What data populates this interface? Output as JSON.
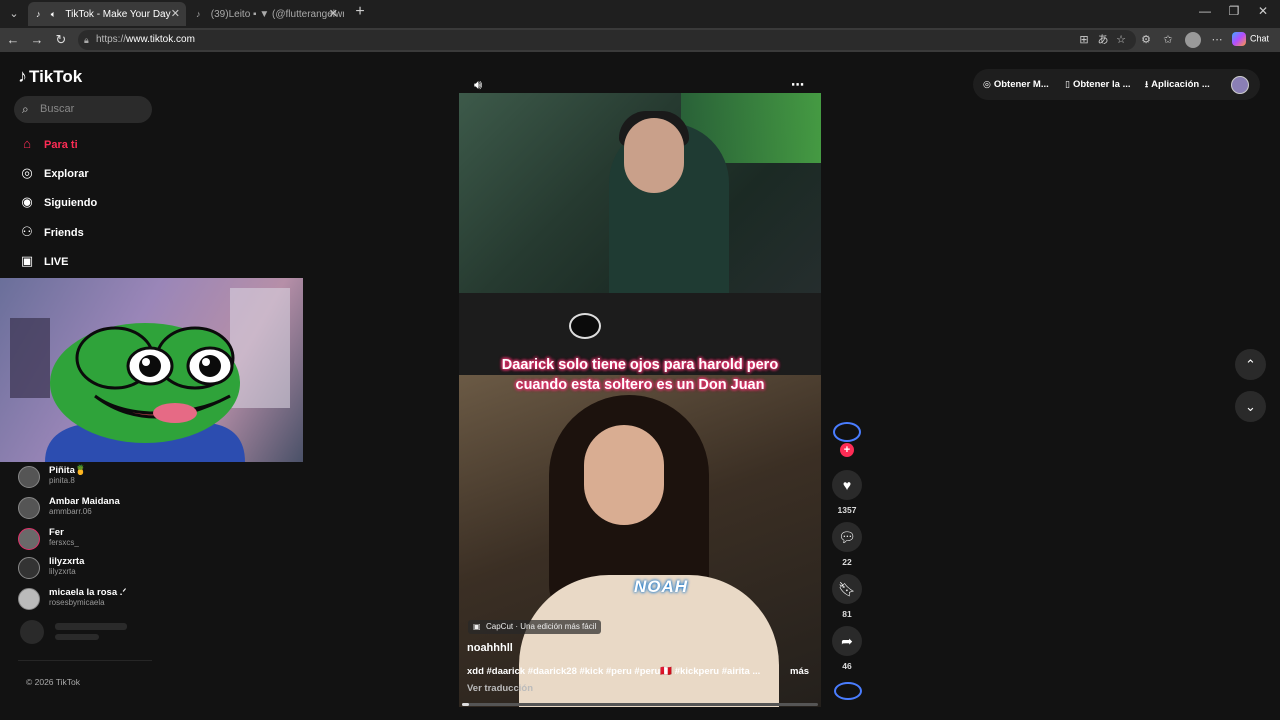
{
  "browser": {
    "tabs": [
      {
        "label": "TikTok - Make Your Day",
        "active": true
      },
      {
        "label": "(39)Leito ▪ ▼ (@flutterangelwrr",
        "active": false
      }
    ],
    "url_scheme": "https://",
    "url_host": "www.tiktok.com",
    "chat_label": "Chat"
  },
  "sidebar": {
    "logo": "TikTok",
    "search_placeholder": "Buscar",
    "nav": [
      {
        "label": "Para ti",
        "icon": "home-icon",
        "active": true
      },
      {
        "label": "Explorar",
        "icon": "compass-icon",
        "active": false
      },
      {
        "label": "Siguiendo",
        "icon": "following-avatar-icon",
        "active": false
      },
      {
        "label": "Friends",
        "icon": "friends-icon",
        "active": false
      },
      {
        "label": "LIVE",
        "icon": "live-icon",
        "active": false
      }
    ],
    "following_accounts": [
      {
        "name": "Piñita🍍",
        "handle": "pinita.8"
      },
      {
        "name": "Ambar Maidana",
        "handle": "ammbarr.06"
      },
      {
        "name": "Fer",
        "handle": "fersxcs_"
      },
      {
        "name": "lilyzxrta",
        "handle": "lilyzxrta"
      },
      {
        "name": "micaela la rosa .ᐟ",
        "handle": "rosesbymicaela"
      }
    ],
    "copyright": "© 2026 TikTok"
  },
  "video": {
    "caption_line1": "Daarick solo tiene ojos para harold pero",
    "caption_line2": "cuando esta soltero es un Don Juan",
    "watermark": "NOAH",
    "capcut_label": "CapCut · Una edición más fácil",
    "author": "noahhhll",
    "description": "xdd #daarick #daarick28 #kick #peru #peru🇵🇪 #kickperu #airita ...",
    "more_label": "más",
    "translate_label": "Ver traducción",
    "progress": 0.02
  },
  "actions": {
    "likes": "1357",
    "comments": "22",
    "saves": "81",
    "shares": "46"
  },
  "topbar": {
    "btn1": "Obtener M...",
    "btn2": "Obtener la ...",
    "btn3": "Aplicación ..."
  },
  "colors": {
    "accent": "#fe2c55",
    "background": "#121212",
    "caption_glow": "#e0336b"
  }
}
